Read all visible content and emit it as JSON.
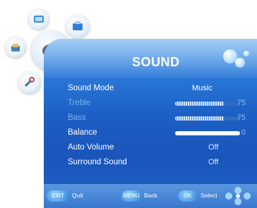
{
  "menu": {
    "title": "SOUND",
    "items": [
      {
        "label": "Sound Mode",
        "value": "Music"
      },
      {
        "label": "Treble",
        "value": "75",
        "level": 0.75
      },
      {
        "label": "Bass",
        "value": "75",
        "level": 0.75
      },
      {
        "label": "Balance",
        "value": "0",
        "level": 0.5
      },
      {
        "label": "Auto Volume",
        "value": "Off"
      },
      {
        "label": "Surround Sound",
        "value": "Off"
      }
    ]
  },
  "hints": [
    {
      "key": "EXIT",
      "label": "Quit"
    },
    {
      "key": "MENU",
      "label": "Back"
    },
    {
      "key": "OK",
      "label": "Select"
    }
  ],
  "side_icons": [
    "picture-icon",
    "channel-icon",
    "sound-icon",
    "lock-icon",
    "setup-icon"
  ],
  "colors": {
    "panel": "#1c5fc4",
    "accent": "#5aa6f0",
    "text": "#ffffff"
  }
}
